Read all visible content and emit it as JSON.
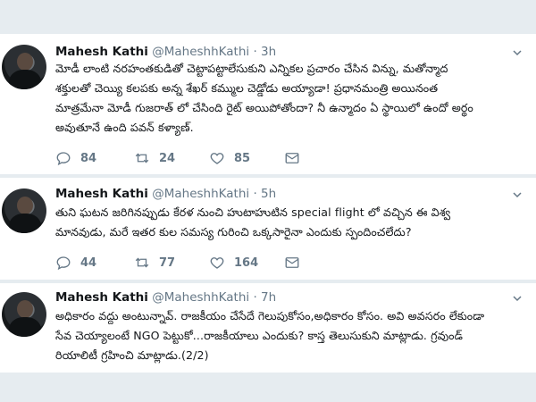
{
  "tweets": [
    {
      "name": "Mahesh Kathi",
      "handle": "@MaheshhKathi",
      "dot": "·",
      "time": "3h",
      "lines": [
        "మోడీ లాంటి నరహంతకుడితో చెట్టాపట్టాలేసుకుని ఎన్నికల ప్రచారం చేసిన విన్ను, మతోన్మాద",
        "శక్తులతో చెయ్యి కలపకు అన్న శేఖర్ కమ్ముల చెడ్డోడు అయ్యాడా! ప్రధానమంత్రి అయినంత",
        "మాత్రమేనా మోడీ గుజరాత్ లో చేసింది రైట్ అయిపోతోందా? నీ ఉన్మాదం ఏ స్థాయిలో ఉందో అర్థం",
        "అవుతూనే ఉంది పవన్ కళ్యాణ్."
      ],
      "replies": "84",
      "retweets": "24",
      "likes": "85"
    },
    {
      "name": "Mahesh Kathi",
      "handle": "@MaheshhKathi",
      "dot": "·",
      "time": "5h",
      "lines": [
        "తుని ఘటన జరిగినప్పుడు కేరళ నుంచి హుటాహుటిన special flight లో వచ్చిన ఈ విశ్వ",
        "మానవుడు, మరే ఇతర కుల సమస్య గురించి ఒక్కసారైనా ఎందుకు స్పందించలేదు?"
      ],
      "replies": "44",
      "retweets": "77",
      "likes": "164"
    },
    {
      "name": "Mahesh Kathi",
      "handle": "@MaheshhKathi",
      "dot": "·",
      "time": "7h",
      "lines": [
        "అధికారం వద్దు అంటున్నావ్. రాజకీయం చేసేదే గెలుపుకోసం,అధికారం కోసం. అవి అవసరం లేకుండా",
        "సేవ చెయ్యాలంటే NGO పెట్టుకో...రాజకీయాలు ఎందుకు? కాస్త తెలుసుకుని మాట్లాడు. గ్రవుండ్",
        "రియాలిటీ గ్రహించి మాట్లాడు.(2/2)"
      ],
      "replies": "",
      "retweets": "",
      "likes": ""
    }
  ],
  "icons": {
    "reply": "reply-icon",
    "retweet": "retweet-icon",
    "like": "heart-icon",
    "dm": "mail-icon",
    "menu": "chevron-down-icon"
  },
  "colors": {
    "text": "#14171a",
    "muted": "#657786",
    "separator": "#e6ecf0"
  }
}
